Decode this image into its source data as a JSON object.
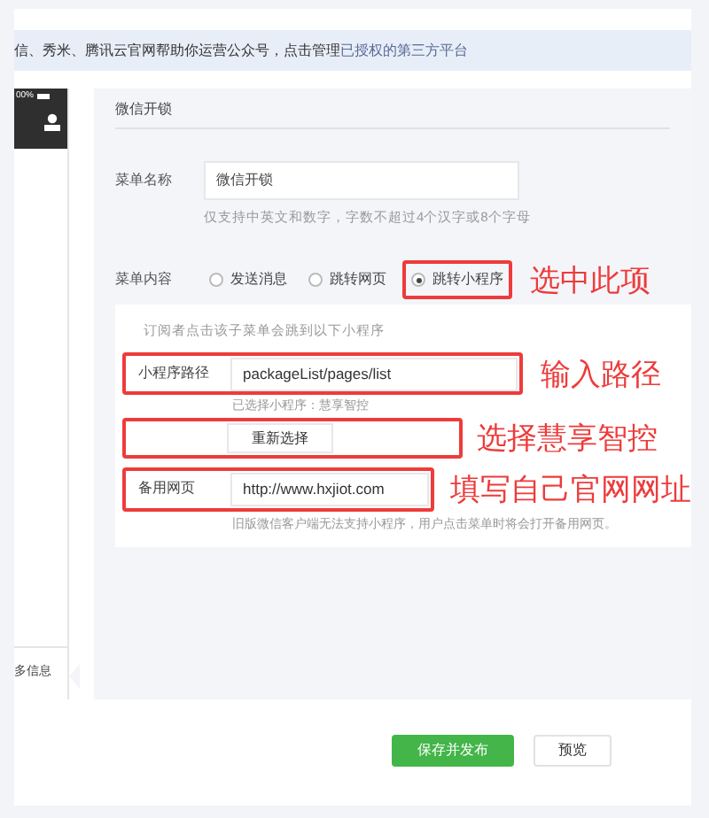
{
  "notice": {
    "text": "信、秀米、腾讯云官网帮助你运营公众号，点击管理",
    "link": "已授权的第三方平台"
  },
  "phone": {
    "battery": "00%",
    "menu_item": "多信息"
  },
  "editor": {
    "header": "微信开锁",
    "menu_name": {
      "label": "菜单名称",
      "value": "微信开锁",
      "hint": "仅支持中英文和数字，字数不超过4个汉字或8个字母"
    },
    "menu_content": {
      "label": "菜单内容",
      "options": [
        {
          "label": "发送消息",
          "selected": false
        },
        {
          "label": "跳转网页",
          "selected": false
        },
        {
          "label": "跳转小程序",
          "selected": true,
          "annotation": "选中此项"
        }
      ]
    },
    "mini_program": {
      "intro": "订阅者点击该子菜单会跳到以下小程序",
      "path": {
        "label": "小程序路径",
        "value": "packageList/pages/list",
        "annotation": "输入路径"
      },
      "selected_note": "已选择小程序：慧享智控",
      "reselect": {
        "label": "重新选择",
        "annotation": "选择慧享智控"
      },
      "backup": {
        "label": "备用网页",
        "value": "http://www.hxjiot.com",
        "annotation": "填写自己官网网址"
      },
      "backup_hint": "旧版微信客户端无法支持小程序，用户点击菜单时将会打开备用网页。"
    }
  },
  "buttons": [
    {
      "label": "保存并发布",
      "kind": "primary"
    },
    {
      "label": "预览",
      "kind": "default"
    }
  ]
}
